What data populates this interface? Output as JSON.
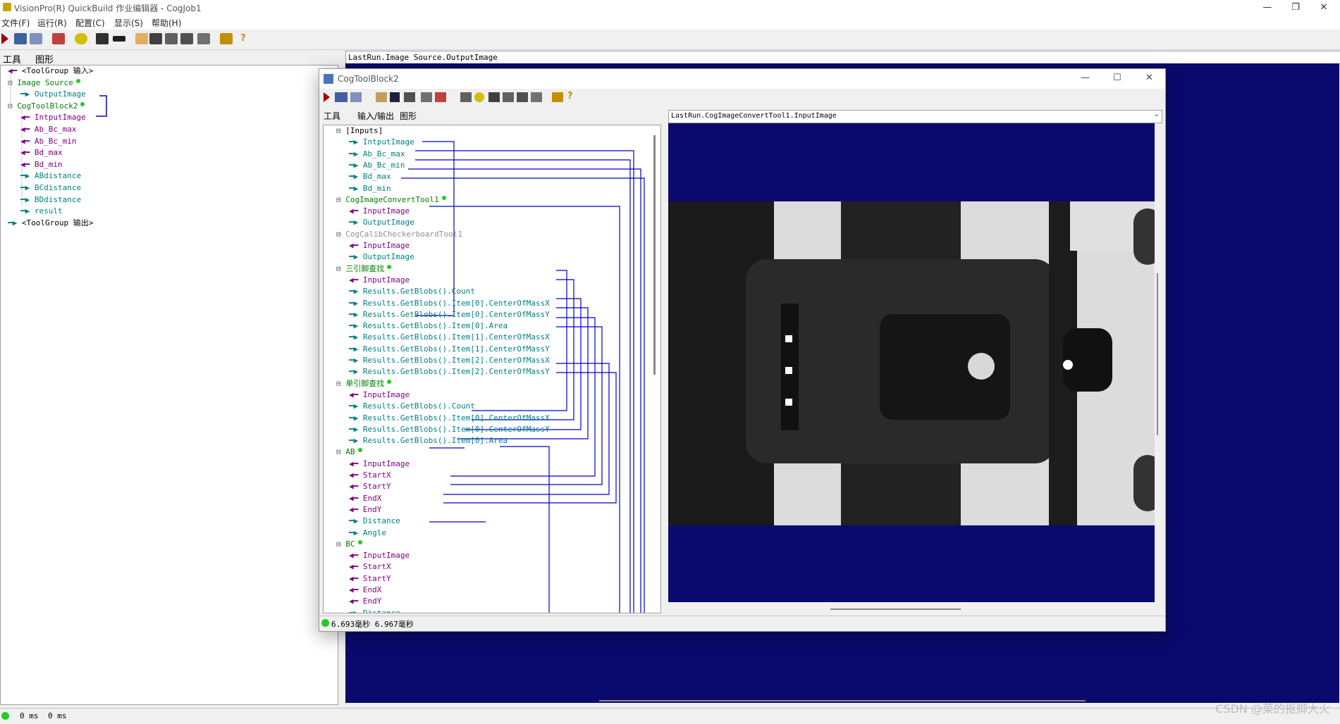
{
  "window": {
    "title": "VisionPro(R) QuickBuild 作业编辑器 - CogJob1"
  },
  "menu": [
    "文件(F)",
    "运行(R)",
    "配置(C)",
    "显示(S)",
    "帮助(H)"
  ],
  "left_tabs": [
    "工具",
    "图形"
  ],
  "left_tree": [
    {
      "label": "<ToolGroup 输入>",
      "color": "#000000",
      "indent": 0,
      "arrow": "in"
    },
    {
      "label": "Image Source",
      "color": "#008000",
      "indent": 0,
      "dot": true
    },
    {
      "label": "OutputImage",
      "color": "#008080",
      "indent": 2,
      "arrow": "out"
    },
    {
      "label": "CogToolBlock2",
      "color": "#008000",
      "indent": 0,
      "dot": true
    },
    {
      "label": "IntputImage",
      "color": "#800080",
      "indent": 2,
      "arrow": "in"
    },
    {
      "label": "Ab_Bc_max",
      "color": "#800080",
      "indent": 2,
      "arrow": "in"
    },
    {
      "label": "Ab_Bc_min",
      "color": "#800080",
      "indent": 2,
      "arrow": "in"
    },
    {
      "label": "Bd_max",
      "color": "#800080",
      "indent": 2,
      "arrow": "in"
    },
    {
      "label": "Bd_min",
      "color": "#800080",
      "indent": 2,
      "arrow": "in"
    },
    {
      "label": "ABdistance",
      "color": "#008080",
      "indent": 2,
      "arrow": "out"
    },
    {
      "label": "BCdistance",
      "color": "#008080",
      "indent": 2,
      "arrow": "out"
    },
    {
      "label": "BDdistance",
      "color": "#008080",
      "indent": 2,
      "arrow": "out"
    },
    {
      "label": "result",
      "color": "#008080",
      "indent": 2,
      "arrow": "out"
    },
    {
      "label": "<ToolGroup 输出>",
      "color": "#000000",
      "indent": 0,
      "arrow": "out"
    }
  ],
  "main_image_path": "LastRun.Image Source.OutputImage",
  "status": {
    "left1": "0 ms",
    "left2": "0 ms"
  },
  "watermark": "CSDN @菜的抠脚大火",
  "child": {
    "title": "CogToolBlock2",
    "tabs": [
      "工具",
      "输入/输出",
      "图形"
    ],
    "image_path": "LastRun.CogImageConvertTool1.InputImage",
    "status": "6.693毫秒 6.967毫秒",
    "tree": [
      {
        "label": "[Inputs]",
        "color": "#000000",
        "indent": 0
      },
      {
        "label": "IntputImage",
        "color": "#008080",
        "indent": 2,
        "arrow": "out"
      },
      {
        "label": "Ab_Bc_max",
        "color": "#008080",
        "indent": 2,
        "arrow": "out"
      },
      {
        "label": "Ab_Bc_min",
        "color": "#008080",
        "indent": 2,
        "arrow": "out"
      },
      {
        "label": "Bd_max",
        "color": "#008080",
        "indent": 2,
        "arrow": "out"
      },
      {
        "label": "Bd_min",
        "color": "#008080",
        "indent": 2,
        "arrow": "out"
      },
      {
        "label": "CogImageConvertTool1",
        "color": "#008000",
        "indent": 0,
        "dot": true
      },
      {
        "label": "InputImage",
        "color": "#800080",
        "indent": 2,
        "arrow": "in"
      },
      {
        "label": "OutputImage",
        "color": "#008080",
        "indent": 2,
        "arrow": "out"
      },
      {
        "label": "CogCalibCheckerboardTool1",
        "color": "#909090",
        "indent": 0
      },
      {
        "label": "InputImage",
        "color": "#800080",
        "indent": 2,
        "arrow": "in"
      },
      {
        "label": "OutputImage",
        "color": "#008080",
        "indent": 2,
        "arrow": "out"
      },
      {
        "label": "三引脚查找",
        "color": "#008000",
        "indent": 0,
        "dot": true
      },
      {
        "label": "InputImage",
        "color": "#800080",
        "indent": 2,
        "arrow": "in"
      },
      {
        "label": "Results.GetBlobs().Count",
        "color": "#008080",
        "indent": 2,
        "arrow": "out"
      },
      {
        "label": "Results.GetBlobs().Item[0].CenterOfMassX",
        "color": "#008080",
        "indent": 2,
        "arrow": "out"
      },
      {
        "label": "Results.GetBlobs().Item[0].CenterOfMassY",
        "color": "#008080",
        "indent": 2,
        "arrow": "out"
      },
      {
        "label": "Results.GetBlobs().Item[0].Area",
        "color": "#008080",
        "indent": 2,
        "arrow": "out"
      },
      {
        "label": "Results.GetBlobs().Item[1].CenterOfMassX",
        "color": "#008080",
        "indent": 2,
        "arrow": "out"
      },
      {
        "label": "Results.GetBlobs().Item[1].CenterOfMassY",
        "color": "#008080",
        "indent": 2,
        "arrow": "out"
      },
      {
        "label": "Results.GetBlobs().Item[2].CenterOfMassX",
        "color": "#008080",
        "indent": 2,
        "arrow": "out"
      },
      {
        "label": "Results.GetBlobs().Item[2].CenterOfMassY",
        "color": "#008080",
        "indent": 2,
        "arrow": "out"
      },
      {
        "label": "单引脚查找",
        "color": "#008000",
        "indent": 0,
        "dot": true
      },
      {
        "label": "InputImage",
        "color": "#800080",
        "indent": 2,
        "arrow": "in"
      },
      {
        "label": "Results.GetBlobs().Count",
        "color": "#008080",
        "indent": 2,
        "arrow": "out"
      },
      {
        "label": "Results.GetBlobs().Item[0].CenterOfMassX",
        "color": "#008080",
        "indent": 2,
        "arrow": "out"
      },
      {
        "label": "Results.GetBlobs().Item[0].CenterOfMassY",
        "color": "#008080",
        "indent": 2,
        "arrow": "out"
      },
      {
        "label": "Results.GetBlobs().Item[0].Area",
        "color": "#008080",
        "indent": 2,
        "arrow": "out"
      },
      {
        "label": "AB",
        "color": "#008000",
        "indent": 0,
        "dot": true
      },
      {
        "label": "InputImage",
        "color": "#800080",
        "indent": 2,
        "arrow": "in"
      },
      {
        "label": "StartX",
        "color": "#800080",
        "indent": 2,
        "arrow": "in"
      },
      {
        "label": "StartY",
        "color": "#800080",
        "indent": 2,
        "arrow": "in"
      },
      {
        "label": "EndX",
        "color": "#800080",
        "indent": 2,
        "arrow": "in"
      },
      {
        "label": "EndY",
        "color": "#800080",
        "indent": 2,
        "arrow": "in"
      },
      {
        "label": "Distance",
        "color": "#008080",
        "indent": 2,
        "arrow": "out"
      },
      {
        "label": "Angle",
        "color": "#008080",
        "indent": 2,
        "arrow": "out"
      },
      {
        "label": "BC",
        "color": "#008000",
        "indent": 0,
        "dot": true
      },
      {
        "label": "InputImage",
        "color": "#800080",
        "indent": 2,
        "arrow": "in"
      },
      {
        "label": "StartX",
        "color": "#800080",
        "indent": 2,
        "arrow": "in"
      },
      {
        "label": "StartY",
        "color": "#800080",
        "indent": 2,
        "arrow": "in"
      },
      {
        "label": "EndX",
        "color": "#800080",
        "indent": 2,
        "arrow": "in"
      },
      {
        "label": "EndY",
        "color": "#800080",
        "indent": 2,
        "arrow": "in"
      },
      {
        "label": "Distance",
        "color": "#008080",
        "indent": 2,
        "arrow": "out"
      }
    ]
  },
  "colors": {
    "image_bg": "#0a0a6e",
    "link_line": "#0000cc",
    "dot": "#22cc22"
  }
}
